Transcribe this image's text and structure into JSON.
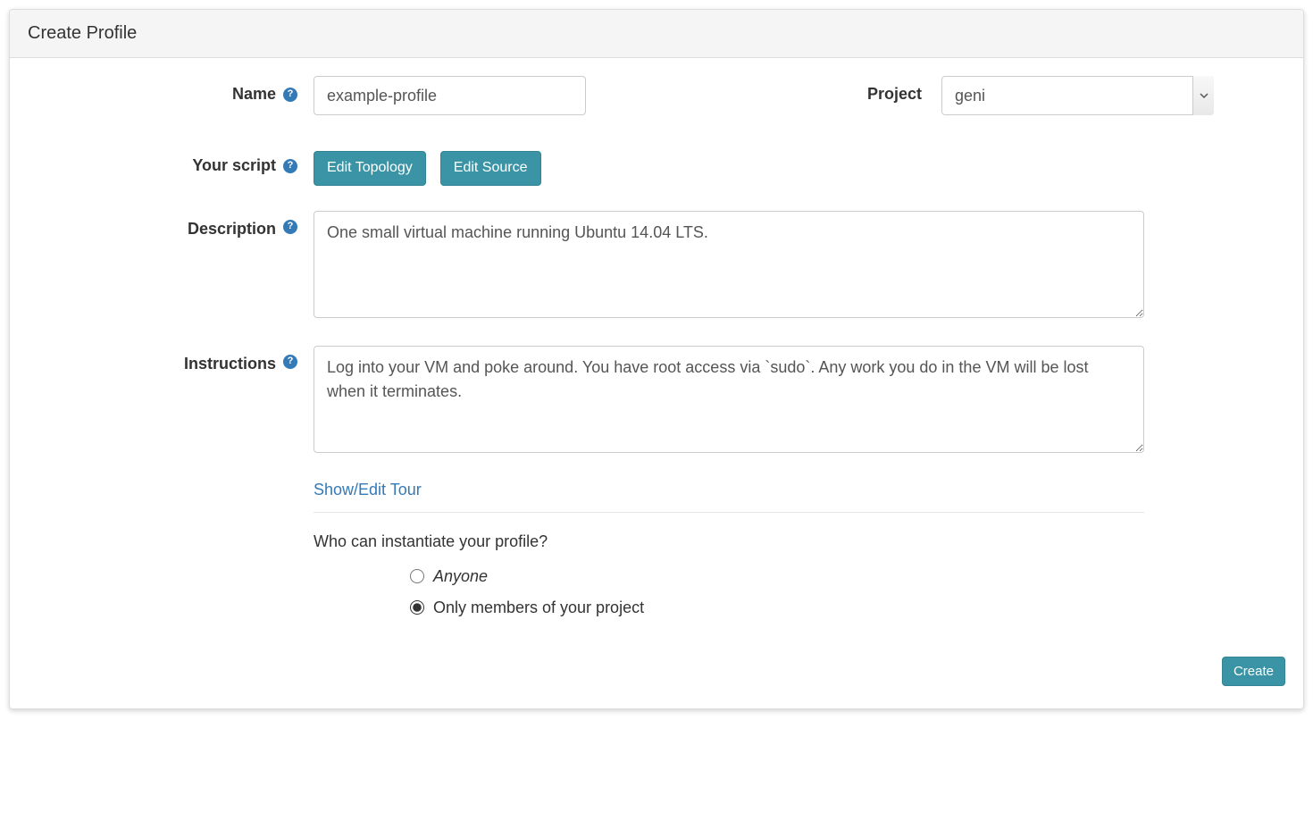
{
  "panel": {
    "title": "Create Profile"
  },
  "labels": {
    "name": "Name",
    "project": "Project",
    "script": "Your script",
    "description": "Description",
    "instructions": "Instructions"
  },
  "fields": {
    "name_value": "example-profile",
    "project_value": "geni",
    "description_value": "One small virtual machine running Ubuntu 14.04 LTS.",
    "instructions_value": "Log into your VM and poke around. You have root access via `sudo`. Any work you do in the VM will be lost when it terminates."
  },
  "buttons": {
    "edit_topology": "Edit Topology",
    "edit_source": "Edit Source",
    "create": "Create"
  },
  "links": {
    "show_edit_tour": "Show/Edit Tour"
  },
  "access": {
    "question": "Who can instantiate your profile?",
    "option_anyone": "Anyone",
    "option_members": "Only members of your project",
    "selected": "members"
  }
}
